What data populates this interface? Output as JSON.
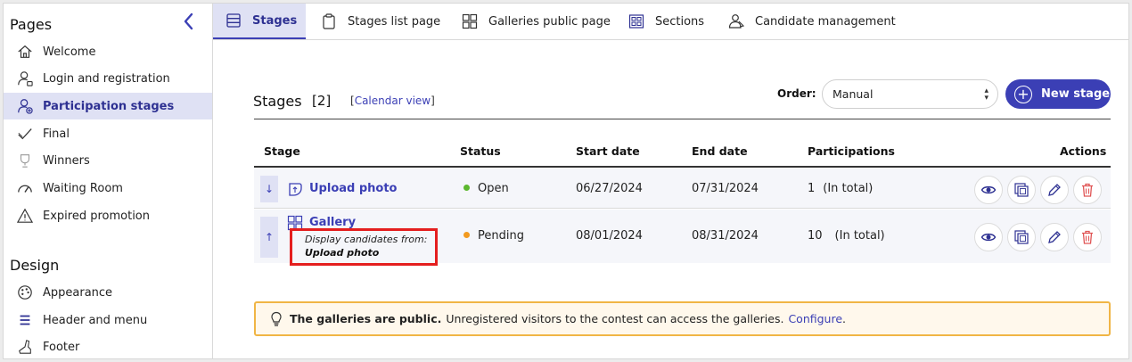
{
  "sidebar": {
    "pages_heading": "Pages",
    "design_heading": "Design",
    "items": [
      {
        "label": "Welcome",
        "icon": "home-icon"
      },
      {
        "label": "Login and registration",
        "icon": "user-lock-icon"
      },
      {
        "label": "Participation stages",
        "icon": "user-plus-icon",
        "active": true
      },
      {
        "label": "Final",
        "icon": "check-icon"
      },
      {
        "label": "Winners",
        "icon": "trophy-icon"
      },
      {
        "label": "Waiting Room",
        "icon": "gauge-icon"
      },
      {
        "label": "Expired promotion",
        "icon": "warning-icon"
      }
    ],
    "design_items": [
      {
        "label": "Appearance",
        "icon": "palette-icon"
      },
      {
        "label": "Header and menu",
        "icon": "menu-icon"
      },
      {
        "label": "Footer",
        "icon": "shoe-icon"
      }
    ]
  },
  "tabs": [
    {
      "label": "Stages",
      "icon": "list-icon",
      "active": true
    },
    {
      "label": "Stages list page",
      "icon": "clipboard-icon"
    },
    {
      "label": "Galleries public page",
      "icon": "grid-icon"
    },
    {
      "label": "Sections",
      "icon": "sections-icon"
    },
    {
      "label": "Candidate management",
      "icon": "users-icon"
    }
  ],
  "stages": {
    "title": "Stages",
    "count": "[2]",
    "calendar_link": "Calendar view",
    "order_label": "Order:",
    "order_value": "Manual",
    "new_button": "New stage"
  },
  "table": {
    "headers": [
      "Stage",
      "Status",
      "Start date",
      "End date",
      "Participations",
      "Actions"
    ],
    "rows": [
      {
        "handle": "↓",
        "name": "Upload photo",
        "icon": "upload-photo-icon",
        "status": "Open",
        "status_color": "#5cb82e",
        "start": "06/27/2024",
        "end": "07/31/2024",
        "participations": "1",
        "participations_note": "(In total)"
      },
      {
        "handle": "↑",
        "name": "Gallery",
        "icon": "gallery-icon",
        "sub_label": "Display candidates from:",
        "sub_value": "Upload photo",
        "status": "Pending",
        "status_color": "#f29a1f",
        "start": "08/01/2024",
        "end": "08/31/2024",
        "participations": "10",
        "participations_note": "(In total)"
      }
    ]
  },
  "notice": {
    "bold": "The galleries are public.",
    "text": "Unregistered visitors to the contest can access the galleries.",
    "link": "Configure",
    "end": "."
  },
  "colors": {
    "accent": "#3b3fb5",
    "active_bg": "#dfe1f4",
    "highlight": "#e41e1e",
    "notice_border": "#f0b545"
  }
}
